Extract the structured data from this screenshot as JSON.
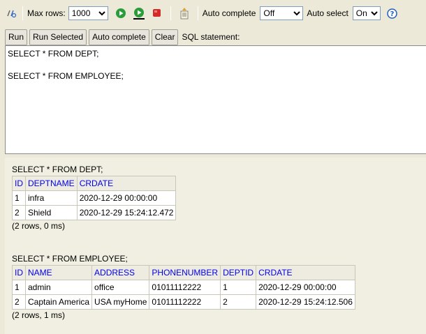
{
  "toolbar": {
    "max_rows_label": "Max rows:",
    "max_rows_value": "1000",
    "auto_complete_label": "Auto complete",
    "auto_complete_value": "Off",
    "auto_select_label": "Auto select",
    "auto_select_value": "On",
    "icons": [
      "refresh-icon",
      "run-icon",
      "run-selected-icon",
      "stop-icon",
      "history-icon",
      "help-icon"
    ]
  },
  "buttons": {
    "run": "Run",
    "run_selected": "Run Selected",
    "auto_complete": "Auto complete",
    "clear": "Clear",
    "sql_statement_label": "SQL statement:"
  },
  "editor": {
    "text": "SELECT * FROM DEPT;\n\nSELECT * FROM EMPLOYEE;"
  },
  "results": {
    "dept": {
      "statement": "SELECT * FROM DEPT;",
      "headers": [
        "ID",
        "DEPTNAME",
        "CRDATE"
      ],
      "rows": [
        [
          "1",
          "infra",
          "2020-12-29 00:00:00"
        ],
        [
          "2",
          "Shield",
          "2020-12-29 15:24:12.472"
        ]
      ],
      "info": "(2 rows, 0 ms)"
    },
    "employee": {
      "statement": "SELECT * FROM EMPLOYEE;",
      "headers": [
        "ID",
        "NAME",
        "ADDRESS",
        "PHONENUMBER",
        "DEPTID",
        "CRDATE"
      ],
      "rows": [
        [
          "1",
          "admin",
          "office",
          "01011112222",
          "1",
          "2020-12-29 00:00:00"
        ],
        [
          "2",
          "Captain America",
          "USA myHome",
          "01011112222",
          "2",
          "2020-12-29 15:24:12.506"
        ]
      ],
      "info": "(2 rows, 1 ms)"
    }
  },
  "colors": {
    "header_link": "#0000ee",
    "background": "#ece9d8",
    "results_background": "#f0efe2"
  }
}
